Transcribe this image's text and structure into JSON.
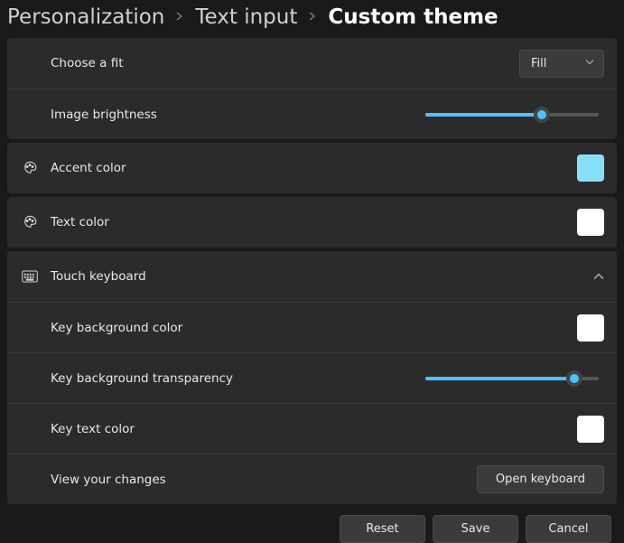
{
  "breadcrumb": {
    "items": [
      "Personalization",
      "Text input",
      "Custom theme"
    ]
  },
  "fit": {
    "label": "Choose a fit",
    "value": "Fill"
  },
  "brightness": {
    "label": "Image brightness",
    "percent": 67
  },
  "accent": {
    "label": "Accent color",
    "color": "#88E0F8"
  },
  "text_color": {
    "label": "Text color",
    "color": "#FFFFFF"
  },
  "touch_keyboard": {
    "label": "Touch keyboard",
    "key_bg": {
      "label": "Key background color",
      "color": "#FFFFFF"
    },
    "key_transparency": {
      "label": "Key background transparency",
      "percent": 86
    },
    "key_text": {
      "label": "Key text color",
      "color": "#FFFFFF"
    },
    "view_changes": {
      "label": "View your changes",
      "button": "Open keyboard"
    }
  },
  "footer": {
    "reset": "Reset",
    "save": "Save",
    "cancel": "Cancel"
  }
}
